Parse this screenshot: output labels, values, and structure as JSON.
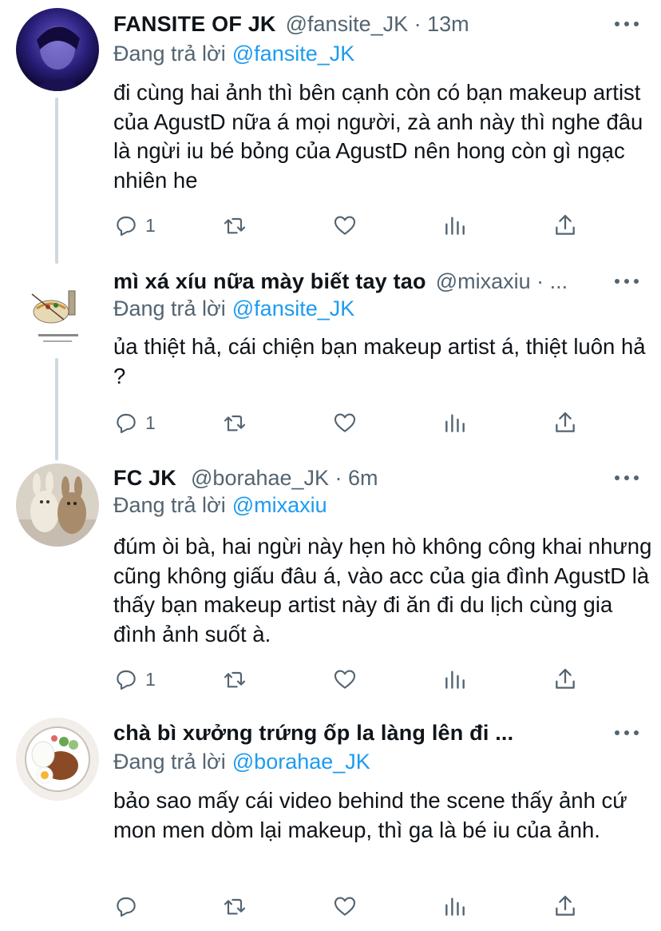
{
  "tweets": [
    {
      "name": "FANSITE OF JK",
      "handle": "@fansite_JK · 13m",
      "replying_prefix": "Đang trả lời",
      "replying_to": "@fansite_JK",
      "text": "đi cùng hai ảnh thì bên cạnh còn có bạn makeup artist của AgustD nữa á mọi người, zà anh này thì nghe đâu là ngừi iu bé bỏng của AgustD nên hong còn gì ngạc nhiên he",
      "reply_count": "1",
      "avatar": "photo-avatar-purple-portrait"
    },
    {
      "name": "mì xá xíu nữa mày biết tay tao",
      "handle": "@mixaxiu · ...",
      "replying_prefix": "Đang trả lời",
      "replying_to": "@fansite_JK",
      "text": "ủa thiệt hả, cái chiện bạn makeup artist á, thiệt luôn hả ?",
      "reply_count": "1",
      "avatar": "photo-avatar-noodle-sketch"
    },
    {
      "name": "FC JK",
      "handle": "@borahae_JK · 6m",
      "replying_prefix": "Đang trả lời",
      "replying_to": "@mixaxiu",
      "text": "đúm òi bà, hai ngừi này hẹn hò không công khai nhưng cũng không giấu đâu á, vào acc của gia đình AgustD là thấy bạn makeup artist này đi ăn đi du lịch cùng gia đình ảnh suốt à.",
      "reply_count": "1",
      "avatar": "photo-avatar-plush-bunnies"
    },
    {
      "name": "chà bì xưởng trứng ốp la làng lên đi ...",
      "handle": "",
      "replying_prefix": "Đang trả lời",
      "replying_to": "@borahae_JK",
      "text": "bảo sao mấy cái video behind the scene thấy ảnh cứ mon men dòm lại makeup, thì ga là bé iu của ảnh.",
      "reply_count": "",
      "avatar": "photo-avatar-rice-plate"
    }
  ],
  "icons": [
    "reply-icon",
    "retweet-icon",
    "like-icon",
    "analytics-icon",
    "share-icon",
    "more-icon"
  ],
  "colors": {
    "text": "#0f1419",
    "secondary": "#536471",
    "mention": "#1d9bf0",
    "thread_line": "#cfd9de"
  }
}
